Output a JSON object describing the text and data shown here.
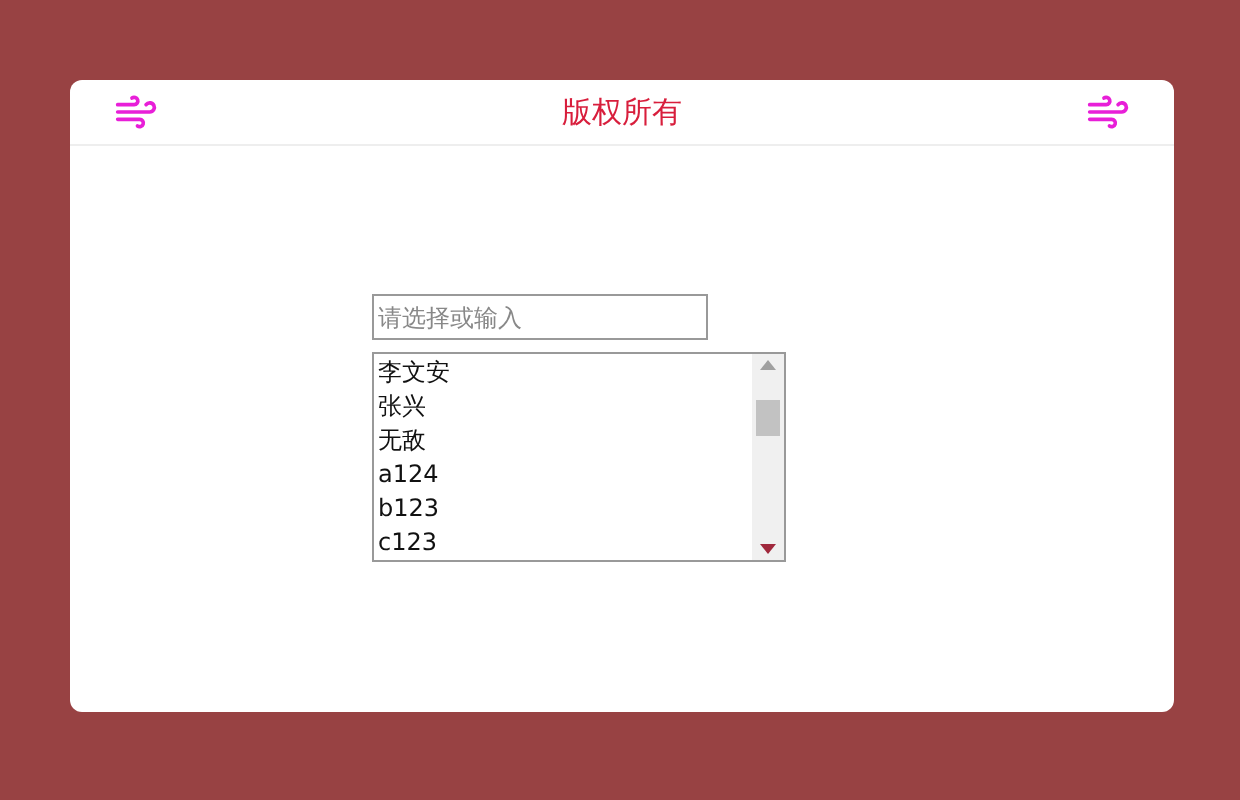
{
  "header": {
    "title": "版权所有"
  },
  "combo": {
    "placeholder": "请选择或输入"
  },
  "options": [
    {
      "label": "李文安",
      "selected": false
    },
    {
      "label": "张兴",
      "selected": false
    },
    {
      "label": "无敌",
      "selected": false
    },
    {
      "label": "a124",
      "selected": false
    },
    {
      "label": "b123",
      "selected": false
    },
    {
      "label": "c123",
      "selected": false
    }
  ]
}
